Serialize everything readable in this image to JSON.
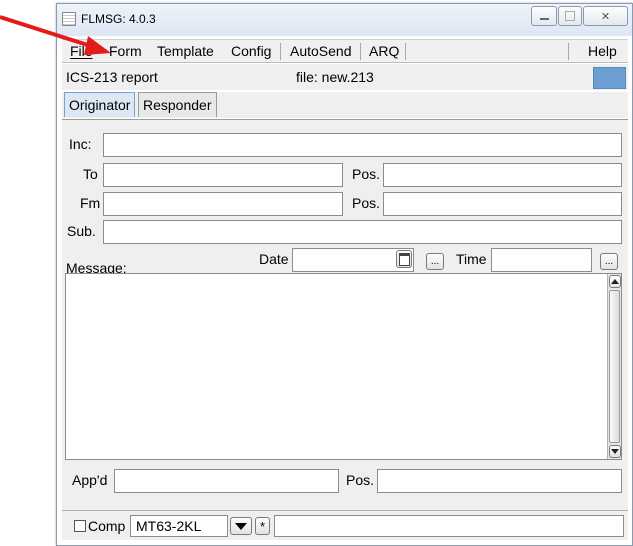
{
  "window": {
    "title": "FLMSG: 4.0.3"
  },
  "menu": {
    "items": [
      "File",
      "Form",
      "Template",
      "Config",
      "AutoSend",
      "ARQ"
    ],
    "help": "Help"
  },
  "status": {
    "report": "ICS-213 report",
    "file": "file: new.213",
    "indicator_color": "#6b9fd4"
  },
  "tabs": [
    "Originator",
    "Responder"
  ],
  "form": {
    "inc_label": "Inc:",
    "to_label": "To",
    "fm_label": "Fm",
    "pos_label": "Pos.",
    "sub_label": "Sub.",
    "message_label": "Message:",
    "date_label": "Date",
    "time_label": "Time",
    "appd_label": "App'd",
    "ellipsis": "...",
    "inc_value": "",
    "to_value": "",
    "fm_value": "",
    "sub_value": ""
  },
  "bottom": {
    "comp_label": "Comp",
    "port_value": "MT63-2KL",
    "star": "*"
  },
  "annotation": {
    "arrow_color": "#e31b1b"
  }
}
